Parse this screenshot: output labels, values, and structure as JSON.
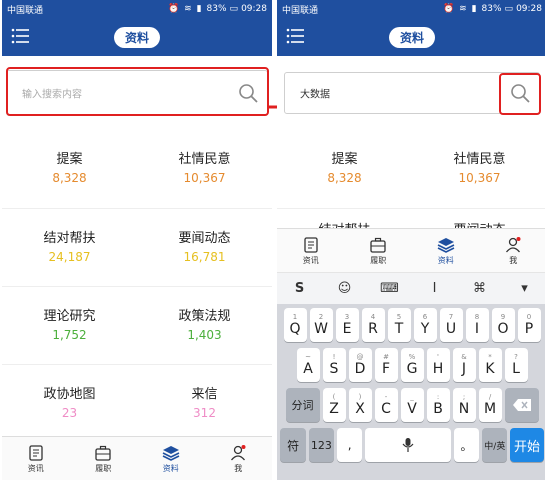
{
  "status": {
    "carrier": "中国联通",
    "battery": "83%",
    "time": "09:28"
  },
  "header": {
    "title": "资料"
  },
  "left_search": {
    "placeholder": "输入搜索内容"
  },
  "right_search": {
    "value": "大数据"
  },
  "categories": [
    {
      "label": "提案",
      "count": "8,328",
      "color": "orange"
    },
    {
      "label": "社情民意",
      "count": "10,367",
      "color": "orange"
    },
    {
      "label": "结对帮扶",
      "count": "24,187",
      "color": "yellow"
    },
    {
      "label": "要闻动态",
      "count": "16,781",
      "color": "yellow"
    },
    {
      "label": "理论研究",
      "count": "1,752",
      "color": "green"
    },
    {
      "label": "政策法规",
      "count": "1,403",
      "color": "green"
    },
    {
      "label": "政协地图",
      "count": "23",
      "color": "pink"
    },
    {
      "label": "来信",
      "count": "312",
      "color": "pink"
    }
  ],
  "partial_row": {
    "left": "结对帮扶",
    "right": "要闻动态"
  },
  "tabs": [
    {
      "label": "资讯",
      "icon": "news-icon"
    },
    {
      "label": "履职",
      "icon": "briefcase-icon"
    },
    {
      "label": "资料",
      "icon": "layers-icon"
    },
    {
      "label": "我",
      "icon": "user-icon"
    }
  ],
  "keyboard": {
    "toolbar": [
      "S",
      "☺",
      "⌨",
      "I",
      "⌘",
      "▾"
    ],
    "row1": [
      [
        "1",
        "Q"
      ],
      [
        "2",
        "W"
      ],
      [
        "3",
        "E"
      ],
      [
        "4",
        "R"
      ],
      [
        "5",
        "T"
      ],
      [
        "6",
        "Y"
      ],
      [
        "7",
        "U"
      ],
      [
        "8",
        "I"
      ],
      [
        "9",
        "O"
      ],
      [
        "0",
        "P"
      ]
    ],
    "row2": [
      [
        "~",
        "A"
      ],
      [
        "!",
        "S"
      ],
      [
        "@",
        "D"
      ],
      [
        "#",
        "F"
      ],
      [
        "%",
        "G"
      ],
      [
        "'",
        "H"
      ],
      [
        "&",
        "J"
      ],
      [
        "*",
        "K"
      ],
      [
        "?",
        "L"
      ]
    ],
    "row3": [
      [
        "(",
        "Z"
      ],
      [
        ")",
        "X"
      ],
      [
        "-",
        "C"
      ],
      [
        "_",
        "V"
      ],
      [
        ":",
        "B"
      ],
      [
        ";",
        "N"
      ],
      [
        "/",
        "M"
      ]
    ],
    "shift_label": "分词",
    "symbols_label": "符",
    "num_label": "123",
    "comma_label": ",",
    "period_label": "。",
    "lang_label": "中/英",
    "enter_label": "开始"
  },
  "colors": {
    "brand": "#1f4f9f",
    "highlight": "#e02020",
    "enter": "#1e88e5"
  }
}
